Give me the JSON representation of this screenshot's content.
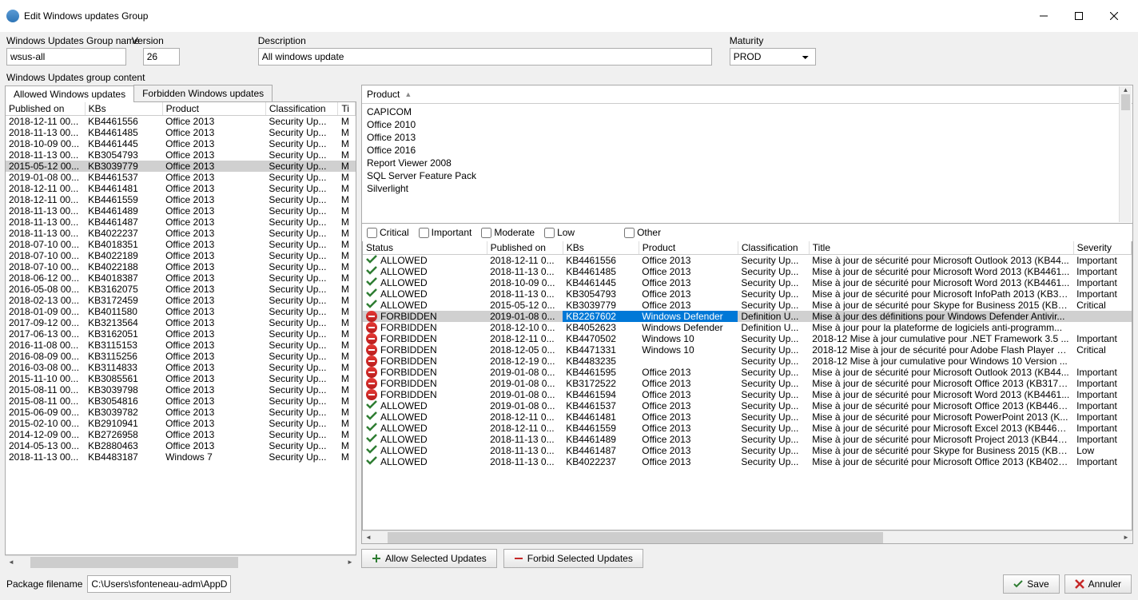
{
  "window": {
    "title": "Edit Windows updates Group",
    "min_tip": "Minimize",
    "max_tip": "Maximize",
    "close_tip": "Close"
  },
  "form": {
    "name_label": "Windows Updates Group name",
    "name_value": "wsus-all",
    "version_label": "Version",
    "version_value": "26",
    "desc_label": "Description",
    "desc_value": "All windows update",
    "maturity_label": "Maturity",
    "maturity_value": "PROD"
  },
  "content_label": "Windows Updates group content",
  "tabs": {
    "allowed": "Allowed Windows updates",
    "forbidden": "Forbidden Windows updates"
  },
  "left_grid": {
    "headers": [
      "Published on",
      "KBs",
      "Product",
      "Classification",
      "Ti"
    ],
    "rows": [
      [
        "2018-12-11 00...",
        "KB4461556",
        "Office 2013",
        "Security Up...",
        "M"
      ],
      [
        "2018-11-13 00...",
        "KB4461485",
        "Office 2013",
        "Security Up...",
        "M"
      ],
      [
        "2018-10-09 00...",
        "KB4461445",
        "Office 2013",
        "Security Up...",
        "M"
      ],
      [
        "2018-11-13 00...",
        "KB3054793",
        "Office 2013",
        "Security Up...",
        "M"
      ],
      [
        "2015-05-12 00...",
        "KB3039779",
        "Office 2013",
        "Security Up...",
        "M"
      ],
      [
        "2019-01-08 00...",
        "KB4461537",
        "Office 2013",
        "Security Up...",
        "M"
      ],
      [
        "2018-12-11 00...",
        "KB4461481",
        "Office 2013",
        "Security Up...",
        "M"
      ],
      [
        "2018-12-11 00...",
        "KB4461559",
        "Office 2013",
        "Security Up...",
        "M"
      ],
      [
        "2018-11-13 00...",
        "KB4461489",
        "Office 2013",
        "Security Up...",
        "M"
      ],
      [
        "2018-11-13 00...",
        "KB4461487",
        "Office 2013",
        "Security Up...",
        "M"
      ],
      [
        "2018-11-13 00...",
        "KB4022237",
        "Office 2013",
        "Security Up...",
        "M"
      ],
      [
        "2018-07-10 00...",
        "KB4018351",
        "Office 2013",
        "Security Up...",
        "M"
      ],
      [
        "2018-07-10 00...",
        "KB4022189",
        "Office 2013",
        "Security Up...",
        "M"
      ],
      [
        "2018-07-10 00...",
        "KB4022188",
        "Office 2013",
        "Security Up...",
        "M"
      ],
      [
        "2018-06-12 00...",
        "KB4018387",
        "Office 2013",
        "Security Up...",
        "M"
      ],
      [
        "2016-05-08 00...",
        "KB3162075",
        "Office 2013",
        "Security Up...",
        "M"
      ],
      [
        "2018-02-13 00...",
        "KB3172459",
        "Office 2013",
        "Security Up...",
        "M"
      ],
      [
        "2018-01-09 00...",
        "KB4011580",
        "Office 2013",
        "Security Up...",
        "M"
      ],
      [
        "2017-09-12 00...",
        "KB3213564",
        "Office 2013",
        "Security Up...",
        "M"
      ],
      [
        "2017-06-13 00...",
        "KB3162051",
        "Office 2013",
        "Security Up...",
        "M"
      ],
      [
        "2016-11-08 00...",
        "KB3115153",
        "Office 2013",
        "Security Up...",
        "M"
      ],
      [
        "2016-08-09 00...",
        "KB3115256",
        "Office 2013",
        "Security Up...",
        "M"
      ],
      [
        "2016-03-08 00...",
        "KB3114833",
        "Office 2013",
        "Security Up...",
        "M"
      ],
      [
        "2015-11-10 00...",
        "KB3085561",
        "Office 2013",
        "Security Up...",
        "M"
      ],
      [
        "2015-08-11 00...",
        "KB3039798",
        "Office 2013",
        "Security Up...",
        "M"
      ],
      [
        "2015-08-11 00...",
        "KB3054816",
        "Office 2013",
        "Security Up...",
        "M"
      ],
      [
        "2015-06-09 00...",
        "KB3039782",
        "Office 2013",
        "Security Up...",
        "M"
      ],
      [
        "2015-02-10 00...",
        "KB2910941",
        "Office 2013",
        "Security Up...",
        "M"
      ],
      [
        "2014-12-09 00...",
        "KB2726958",
        "Office 2013",
        "Security Up...",
        "M"
      ],
      [
        "2014-05-13 00...",
        "KB2880463",
        "Office 2013",
        "Security Up...",
        "M"
      ],
      [
        "2018-11-13 00...",
        "KB4483187",
        "Windows 7",
        "Security Up...",
        "M"
      ]
    ],
    "selected_index": 4
  },
  "product_panel": {
    "header": "Product",
    "items": [
      "CAPICOM",
      "Office 2010",
      "Office 2013",
      "Office 2016",
      "Report Viewer 2008",
      "SQL Server Feature Pack",
      "Silverlight"
    ]
  },
  "filters": {
    "critical": "Critical",
    "important": "Important",
    "moderate": "Moderate",
    "low": "Low",
    "other": "Other"
  },
  "right_grid": {
    "headers": [
      "Status",
      "Published on",
      "KBs",
      "Product",
      "Classification",
      "Title",
      "Severity"
    ],
    "rows": [
      {
        "status": "ALLOWED",
        "pub": "2018-12-11 0...",
        "kb": "KB4461556",
        "product": "Office 2013",
        "class": "Security Up...",
        "title": "Mise à jour de sécurité pour Microsoft Outlook 2013 (KB44...",
        "sev": "Important"
      },
      {
        "status": "ALLOWED",
        "pub": "2018-11-13 0...",
        "kb": "KB4461485",
        "product": "Office 2013",
        "class": "Security Up...",
        "title": "Mise à jour de sécurité pour Microsoft Word 2013 (KB4461...",
        "sev": "Important"
      },
      {
        "status": "ALLOWED",
        "pub": "2018-10-09 0...",
        "kb": "KB4461445",
        "product": "Office 2013",
        "class": "Security Up...",
        "title": "Mise à jour de sécurité pour Microsoft Word 2013 (KB4461...",
        "sev": "Important"
      },
      {
        "status": "ALLOWED",
        "pub": "2018-11-13 0...",
        "kb": "KB3054793",
        "product": "Office 2013",
        "class": "Security Up...",
        "title": "Mise à jour de sécurité pour Microsoft InfoPath 2013 (KB30...",
        "sev": "Important"
      },
      {
        "status": "ALLOWED",
        "pub": "2015-05-12 0...",
        "kb": "KB3039779",
        "product": "Office 2013",
        "class": "Security Up...",
        "title": "Mise à jour de sécurité pour Skype for Business 2015 (KB30...",
        "sev": "Critical"
      },
      {
        "status": "FORBIDDEN",
        "pub": "2019-01-08 0...",
        "kb": "KB2267602",
        "product": "Windows Defender",
        "class": "Definition U...",
        "title": "Mise à jour des définitions pour Windows Defender Antivir...",
        "sev": "",
        "selected": true
      },
      {
        "status": "FORBIDDEN",
        "pub": "2018-12-10 0...",
        "kb": "KB4052623",
        "product": "Windows Defender",
        "class": "Definition U...",
        "title": "Mise à jour pour la plateforme de logiciels anti-programm...",
        "sev": ""
      },
      {
        "status": "FORBIDDEN",
        "pub": "2018-12-11 0...",
        "kb": "KB4470502",
        "product": "Windows 10",
        "class": "Security Up...",
        "title": "2018-12 Mise à jour cumulative pour .NET Framework 3.5 ...",
        "sev": "Important"
      },
      {
        "status": "FORBIDDEN",
        "pub": "2018-12-05 0...",
        "kb": "KB4471331",
        "product": "Windows 10",
        "class": "Security Up...",
        "title": "2018-12 Mise à jour de sécurité pour Adobe Flash Player so...",
        "sev": "Critical"
      },
      {
        "status": "FORBIDDEN",
        "pub": "2018-12-19 0...",
        "kb": "KB4483235",
        "product": "",
        "class": "Security Up...",
        "title": "2018-12 Mise à jour cumulative pour Windows 10 Version ...",
        "sev": ""
      },
      {
        "status": "FORBIDDEN",
        "pub": "2019-01-08 0...",
        "kb": "KB4461595",
        "product": "Office 2013",
        "class": "Security Up...",
        "title": "Mise à jour de sécurité pour Microsoft Outlook 2013 (KB44...",
        "sev": "Important"
      },
      {
        "status": "FORBIDDEN",
        "pub": "2019-01-08 0...",
        "kb": "KB3172522",
        "product": "Office 2013",
        "class": "Security Up...",
        "title": "Mise à jour de sécurité pour Microsoft Office 2013 (KB3172...",
        "sev": "Important"
      },
      {
        "status": "FORBIDDEN",
        "pub": "2019-01-08 0...",
        "kb": "KB4461594",
        "product": "Office 2013",
        "class": "Security Up...",
        "title": "Mise à jour de sécurité pour Microsoft Word 2013 (KB4461...",
        "sev": "Important"
      },
      {
        "status": "ALLOWED",
        "pub": "2019-01-08 0...",
        "kb": "KB4461537",
        "product": "Office 2013",
        "class": "Security Up...",
        "title": "Mise à jour de sécurité pour Microsoft Office 2013 (KB4461...",
        "sev": "Important"
      },
      {
        "status": "ALLOWED",
        "pub": "2018-12-11 0...",
        "kb": "KB4461481",
        "product": "Office 2013",
        "class": "Security Up...",
        "title": "Mise à jour de sécurité pour Microsoft PowerPoint 2013 (K...",
        "sev": "Important"
      },
      {
        "status": "ALLOWED",
        "pub": "2018-12-11 0...",
        "kb": "KB4461559",
        "product": "Office 2013",
        "class": "Security Up...",
        "title": "Mise à jour de sécurité pour Microsoft Excel 2013 (KB44615...",
        "sev": "Important"
      },
      {
        "status": "ALLOWED",
        "pub": "2018-11-13 0...",
        "kb": "KB4461489",
        "product": "Office 2013",
        "class": "Security Up...",
        "title": "Mise à jour de sécurité pour Microsoft Project 2013 (KB446...",
        "sev": "Important"
      },
      {
        "status": "ALLOWED",
        "pub": "2018-11-13 0...",
        "kb": "KB4461487",
        "product": "Office 2013",
        "class": "Security Up...",
        "title": "Mise à jour de sécurité pour Skype for Business 2015 (KB44...",
        "sev": "Low"
      },
      {
        "status": "ALLOWED",
        "pub": "2018-11-13 0...",
        "kb": "KB4022237",
        "product": "Office 2013",
        "class": "Security Up...",
        "title": "Mise à jour de sécurité pour Microsoft Office 2013 (KB4022...",
        "sev": "Important"
      }
    ]
  },
  "actions": {
    "allow": "Allow Selected Updates",
    "forbid": "Forbid Selected Updates"
  },
  "bottom": {
    "filename_label": "Package filename",
    "filename_value": "C:\\Users\\sfonteneau-adm\\AppData\\",
    "save": "Save",
    "cancel": "Annuler"
  }
}
